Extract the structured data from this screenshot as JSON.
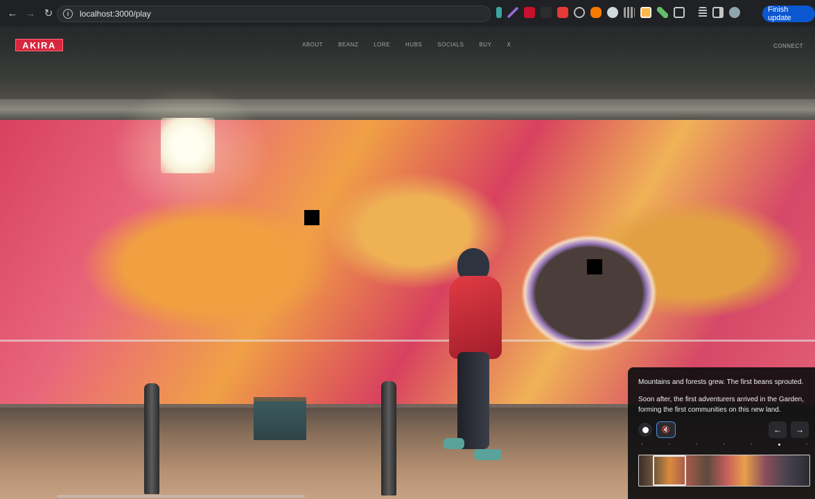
{
  "browser": {
    "url": "localhost:3000/play",
    "finish_update_label": "Finish update",
    "extension_icons": [
      "extension-teal-icon",
      "extension-purple-feather-icon",
      "extension-red-m-icon",
      "extension-dark-icon",
      "extension-red-icon",
      "extension-circle-icon",
      "extension-fox-icon",
      "extension-globe-icon",
      "extension-grid-icon",
      "extension-orange-square-icon",
      "extension-green-leaf-icon",
      "puzzle-icon",
      "media-icon",
      "sidebar-icon",
      "profile-avatar-icon"
    ]
  },
  "site": {
    "logo": "AKIRA",
    "nav": [
      "ABOUT",
      "BEANZ",
      "LORE",
      "HUBS",
      "SOCIALS",
      "BUY",
      "Ⅹ"
    ],
    "connect_label": "CONNECT"
  },
  "story": {
    "paragraph_1": "Mountains and forests grew. The first beans sprouted.",
    "paragraph_2": "Soon after, the first adventurers arrived in the Garden, forming the first communities on this new land.",
    "mute_icon": "🔇",
    "prev_icon": "←",
    "next_icon": "→",
    "progress_active_index": 5,
    "progress_count": 7
  },
  "colors": {
    "logo_red": "#d7263d",
    "finish_blue": "#0b57d0",
    "mute_border": "#4a90e2"
  }
}
